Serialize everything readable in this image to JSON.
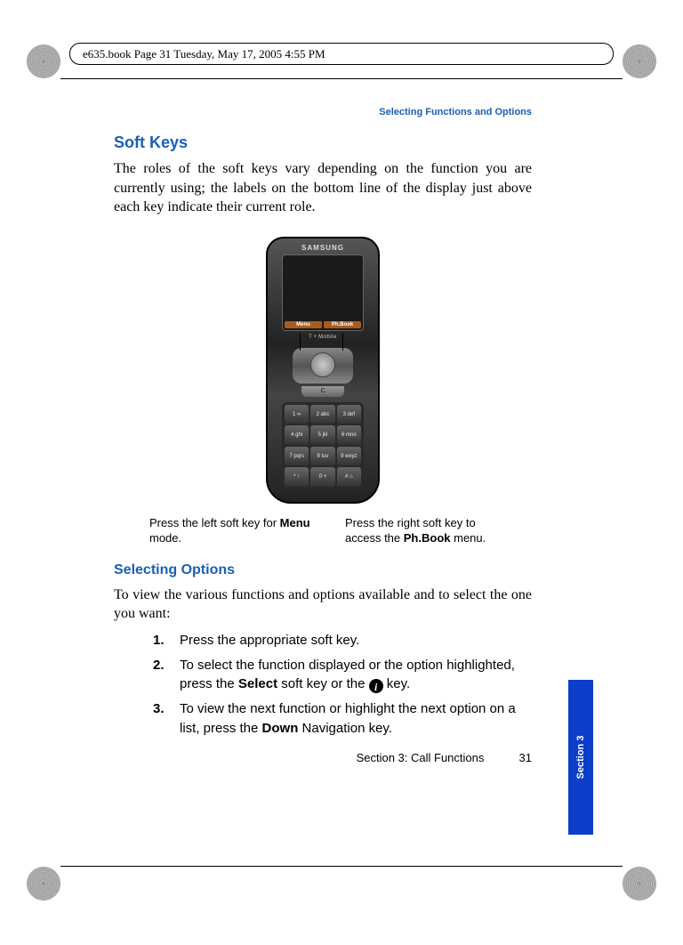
{
  "header_meta": "e635.book  Page 31  Tuesday, May 17, 2005  4:55 PM",
  "running_head": "Selecting Functions and Options",
  "h_soft_keys": "Soft Keys",
  "p_soft_keys": "The roles of the soft keys vary depending on the function you are currently using; the labels on the bottom line of the display just above each key indicate their current role.",
  "phone": {
    "brand": "SAMSUNG",
    "carrier": "T • Mobile",
    "soft_left": "Menu",
    "soft_right": "Ph.Book",
    "clear": "C",
    "keys": [
      "1 ∞",
      "2 abc",
      "3 def",
      "4 ghi",
      "5 jkl",
      "6 mno",
      "7 pqrs",
      "8 tuv",
      "9 wxyz",
      "* ↑",
      "0 +",
      "# ⌂"
    ]
  },
  "caption_left_a": "Press the left soft key for ",
  "caption_left_b": "Menu",
  "caption_left_c": " mode.",
  "caption_right_a": "Press the right soft key to access the ",
  "caption_right_b": "Ph.Book",
  "caption_right_c": " menu.",
  "h_selecting": "Selecting Options",
  "p_selecting": "To view the various functions and options available and to select the one you want:",
  "steps": {
    "s1_num": "1.",
    "s1_txt": "Press the appropriate soft key.",
    "s2_num": "2.",
    "s2_a": "To select the function displayed or the option highlighted, press the ",
    "s2_b": "Select",
    "s2_c": " soft key or the ",
    "s2_icon": "i",
    "s2_d": " key.",
    "s3_num": "3.",
    "s3_a": "To view the next function or highlight the next option on a list, press the ",
    "s3_b": "Down",
    "s3_c": " Navigation key."
  },
  "footer_section": "Section 3: Call Functions",
  "footer_page": "31",
  "side_tab": "Section 3"
}
